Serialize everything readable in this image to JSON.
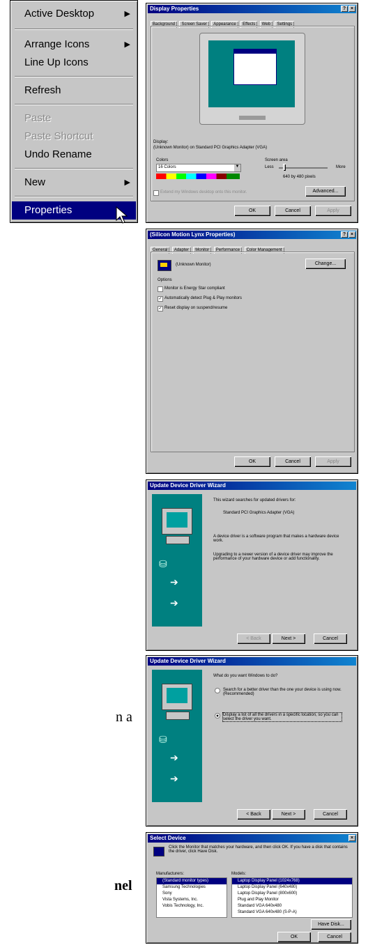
{
  "context_menu": {
    "items": [
      {
        "label": "Active Desktop",
        "submenu": true
      },
      {
        "label": "Arrange Icons",
        "submenu": true
      },
      {
        "label": "Line Up Icons"
      },
      {
        "label": "Refresh"
      },
      {
        "label": "Paste",
        "disabled": true
      },
      {
        "label": "Paste Shortcut",
        "disabled": true
      },
      {
        "label": "Undo Rename"
      },
      {
        "label": "New",
        "submenu": true
      },
      {
        "label": "Properties",
        "selected": true
      }
    ]
  },
  "display_properties": {
    "title": "Display Properties",
    "tabs": [
      "Background",
      "Screen Saver",
      "Appearance",
      "Effects",
      "Web",
      "Settings"
    ],
    "display_label": "Display:",
    "display_value": "(Unknown Monitor) on Standard PCI Graphics Adapter (VGA)",
    "colors_label": "Colors",
    "colors_value": "16 Colors",
    "screen_area_label": "Screen area",
    "screen_less": "Less",
    "screen_more": "More",
    "screen_value": "640 by 480 pixels",
    "extend_label": "Extend my Windows desktop onto this monitor.",
    "advanced_button": "Advanced...",
    "ok": "OK",
    "cancel": "Cancel",
    "apply": "Apply"
  },
  "adapter_properties": {
    "title": "(Silicon Motion Lynx Properties)",
    "tabs": [
      "General",
      "Adapter",
      "Monitor",
      "Performance",
      "Color Management"
    ],
    "monitor_name": "(Unknown Monitor)",
    "change_button": "Change...",
    "options_label": "Options",
    "options": [
      {
        "label": "Monitor is Energy Star compliant",
        "checked": false
      },
      {
        "label": "Automatically detect Plug & Play monitors",
        "checked": true
      },
      {
        "label": "Reset display on suspend/resume",
        "checked": true
      }
    ],
    "ok": "OK",
    "cancel": "Cancel",
    "apply": "Apply"
  },
  "wizard1": {
    "title": "Update Device Driver Wizard",
    "line1": "This wizard searches for updated drivers for:",
    "device": "Standard PCI Graphics Adapter (VGA)",
    "para1": "A device driver is a software program that makes a hardware device work.",
    "para2": "Upgrading to a newer version of a device driver may improve the performance of your hardware device or add functionality.",
    "back": "< Back",
    "next": "Next >",
    "cancel": "Cancel"
  },
  "wizard2": {
    "title": "Update Device Driver Wizard",
    "question": "What do you want Windows to do?",
    "option1": "Search for a better driver than the one your device is using now. (Recommended)",
    "option2": "Display a list of all the drivers in a specific location, so you can select the driver you want.",
    "back": "< Back",
    "next": "Next >",
    "cancel": "Cancel"
  },
  "select_device": {
    "title": "Select Device",
    "instruction": "Click the Monitor that matches your hardware, and then click OK. If you have a disk that contains the driver, click Have Disk.",
    "manufacturers_label": "Manufacturers:",
    "manufacturers": [
      "(Standard monitor types)",
      "Samsung Technologies",
      "Sony",
      "Vista Systems, Inc.",
      "Vobis Technology, Inc."
    ],
    "models_label": "Models:",
    "models": [
      "Laptop Display Panel (1024x768)",
      "Laptop Display Panel (640x480)",
      "Laptop Display Panel (800x600)",
      "Plug and Play Monitor",
      "Standard VGA 640x480",
      "Standard VGA 640x480 (S-P-A)"
    ],
    "have_disk": "Have Disk...",
    "ok": "OK",
    "cancel": "Cancel"
  },
  "side_text": {
    "fragment1": "n a",
    "fragment2": "nel"
  }
}
